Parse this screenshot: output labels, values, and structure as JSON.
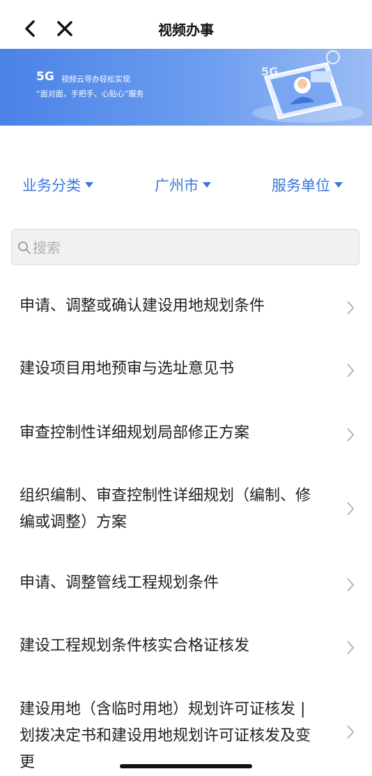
{
  "header": {
    "title": "视频办事",
    "back_icon": "chevron-left-icon",
    "close_icon": "close-icon"
  },
  "banner": {
    "badge": "5G",
    "line1": "视频云导办轻松实现",
    "line2": "“面对面，手把手、心贴心”服务"
  },
  "filters": [
    {
      "label": "业务分类"
    },
    {
      "label": "广州市"
    },
    {
      "label": "服务单位"
    }
  ],
  "search": {
    "placeholder": "搜索",
    "value": ""
  },
  "items": [
    {
      "label": "申请、调整或确认建设用地规划条件"
    },
    {
      "label": "建设项目用地预审与选址意见书"
    },
    {
      "label": "审查控制性详细规划局部修正方案"
    },
    {
      "label": "组织编制、审查控制性详细规划（编制、修编或调整）方案"
    },
    {
      "label": "申请、调整管线工程规划条件"
    },
    {
      "label": "建设工程规划条件核实合格证核发"
    },
    {
      "label": "建设用地（含临时用地）规划许可证核发 | 划拨决定书和建设用地规划许可证核发及变更"
    }
  ],
  "colors": {
    "accent": "#3b77d8",
    "banner": "#5a90ea"
  }
}
